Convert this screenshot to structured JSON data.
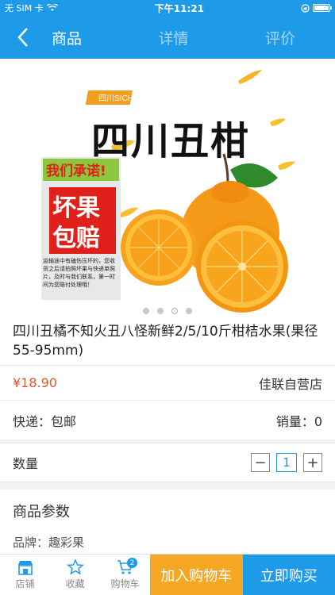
{
  "status_bar": {
    "carrier": "无 SIM 卡",
    "time": "下午11:21"
  },
  "nav": {
    "tabs": [
      {
        "label": "商品"
      },
      {
        "label": "详情"
      },
      {
        "label": "评价"
      }
    ]
  },
  "hero": {
    "banner_tag": "四川SICHUAN",
    "brand_text": "四川丑柑",
    "promise": "我们承诺!",
    "guarantee_line1": "坏果",
    "guarantee_line2": "包赔",
    "guarantee_note": "运输途中有磕伤压坏的，您收货之后请拍照坏果与快递单照片，及时与我们联系，第一时间为您赔付处理哦！",
    "carousel_total": 4,
    "carousel_current": 3
  },
  "product": {
    "title": "四川丑橘不知火丑八怪新鲜2/5/10斤柑桔水果(果径55-95mm)",
    "price": "¥18.90",
    "store": "佳联自营店",
    "shipping_label": "快递：包邮",
    "sales_label": "销量：0",
    "qty_label": "数量",
    "qty_value": "1",
    "qty_minus": "−",
    "qty_plus": "+"
  },
  "params": {
    "heading": "商品参数",
    "brand": "品牌：趣彩果"
  },
  "bottom": {
    "store_label": "店铺",
    "fav_label": "收藏",
    "cart_label": "购物车",
    "cart_count": "2",
    "add_cart": "加入购物车",
    "buy_now": "立即购买"
  },
  "colors": {
    "primary": "#1e9be8",
    "accent": "#f5a623",
    "price": "#e3582a"
  }
}
